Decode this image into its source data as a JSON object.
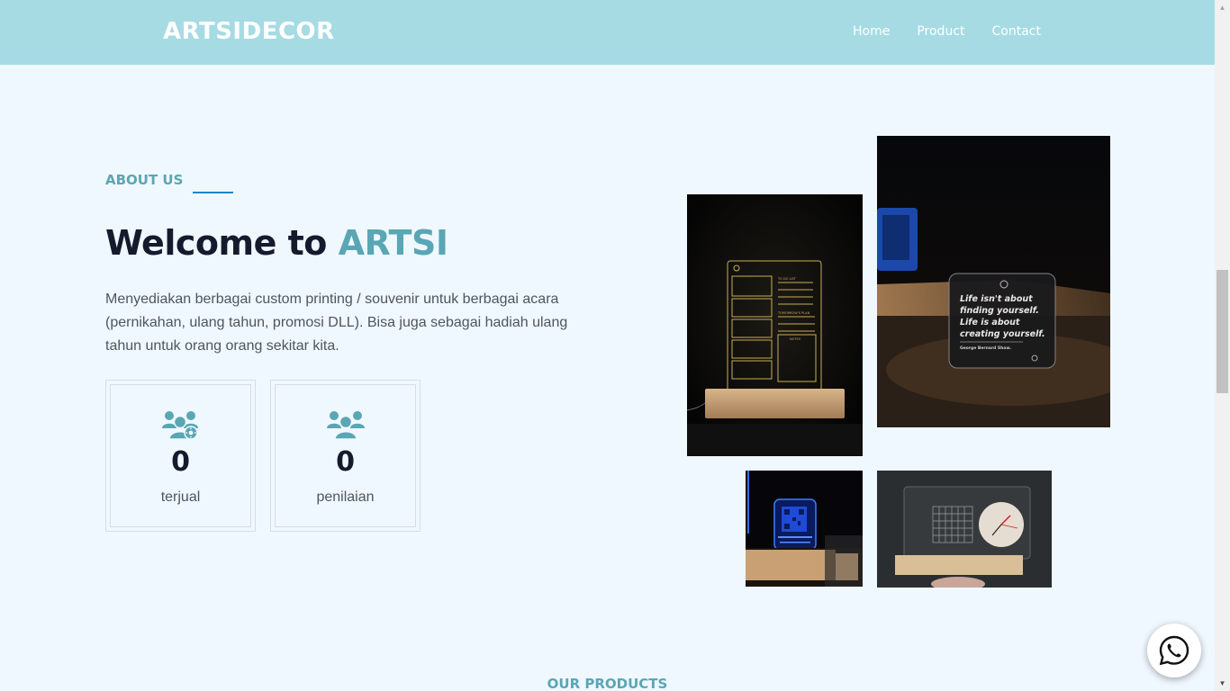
{
  "brand": "ARTSIDECOR",
  "nav": {
    "home": "Home",
    "product": "Product",
    "contact": "Contact"
  },
  "about": {
    "label": "ABOUT US",
    "welcome_prefix": "Welcome to ",
    "welcome_accent": "ARTSI",
    "description": "Menyediakan berbagai custom printing / souvenir untuk berbagai acara (pernikahan, ulang tahun, promosi DLL). Bisa juga sebagai hadiah ulang tahun untuk orang orang sekitar kita."
  },
  "stats": [
    {
      "icon": "users-gear-icon",
      "value": "0",
      "label": "terjual"
    },
    {
      "icon": "users-icon",
      "value": "0",
      "label": "penilaian"
    }
  ],
  "gallery": {
    "quote_lines": [
      "Life isn't about",
      "finding yourself.",
      "Life is about",
      "creating yourself."
    ],
    "quote_author": "George Bernard Shaw.",
    "todo_title": "TO DO LIST",
    "todo_plan": "TOMORROW'S PLAN",
    "todo_notes": "NOTES"
  },
  "products_title": "OUR PRODUCTS",
  "colors": {
    "navbar": "#a6dbe4",
    "accent": "#5aa6b4",
    "background": "#f0f8ff",
    "heading": "#151a2d",
    "line": "#1a86c8"
  },
  "whatsapp": {
    "icon": "whatsapp-icon"
  }
}
